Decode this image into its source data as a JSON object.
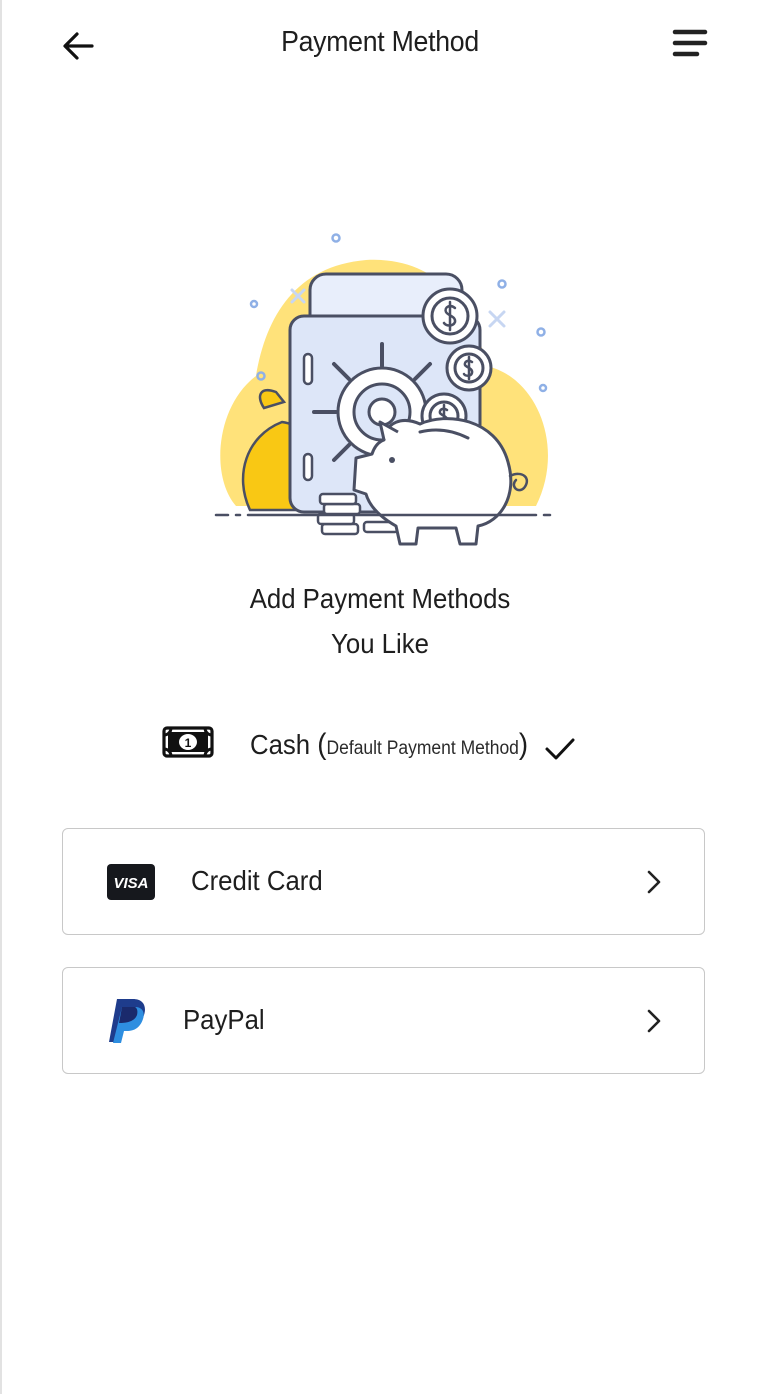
{
  "header": {
    "title": "Payment Method",
    "back_icon": "arrow-left-icon",
    "menu_icon": "hamburger-menu-icon"
  },
  "illustration": {
    "icon": "safe-piggy-bank-illustration",
    "accent_color": "#FFE27A",
    "coin_color": "#F9C814",
    "line_color": "#4A4F63",
    "fill_color": "#DDE6F8"
  },
  "headline": {
    "line1": "Add Payment Methods",
    "line2": "You Like"
  },
  "cash": {
    "icon": "banknote-icon",
    "label": "Cash",
    "open_paren": "(",
    "note": "Default Payment Method",
    "close_paren": ")",
    "selected_icon": "checkmark-icon"
  },
  "methods": [
    {
      "label": "Credit Card",
      "icon": "visa-card-icon",
      "brand_text": "VISA",
      "chevron": "chevron-right-icon"
    },
    {
      "label": "PayPal",
      "icon": "paypal-icon",
      "chevron": "chevron-right-icon"
    }
  ]
}
